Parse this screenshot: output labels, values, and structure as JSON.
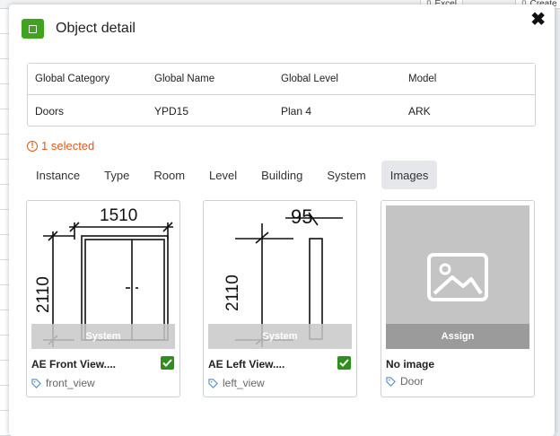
{
  "background": {
    "tabs": [
      "Excel",
      "Create"
    ]
  },
  "modal": {
    "title": "Object detail",
    "close_label": "✖"
  },
  "info_table": {
    "headers": [
      "Global Category",
      "Global Name",
      "Global Level",
      "Model"
    ],
    "row": [
      "Doors",
      "YPD15",
      "Plan 4",
      "ARK"
    ]
  },
  "selection": {
    "text": "1 selected"
  },
  "tabs": [
    "Instance",
    "Type",
    "Room",
    "Level",
    "Building",
    "System",
    "Images"
  ],
  "active_tab": "Images",
  "cards": [
    {
      "name": "AE Front View....",
      "tag": "front_view",
      "overlay": "System",
      "checked": true,
      "drawing": {
        "width_label": "1510",
        "height_label": "2110"
      }
    },
    {
      "name": "AE Left View....",
      "tag": "left_view",
      "overlay": "System",
      "checked": true,
      "drawing": {
        "width_label": "95",
        "height_label": "2110"
      }
    },
    {
      "name": "No image",
      "tag": "Door",
      "overlay": "Assign",
      "checked": false
    }
  ],
  "colors": {
    "accent_green": "#3fa320",
    "warning_orange": "#e05a1c",
    "check_green": "#2e8f1c"
  }
}
